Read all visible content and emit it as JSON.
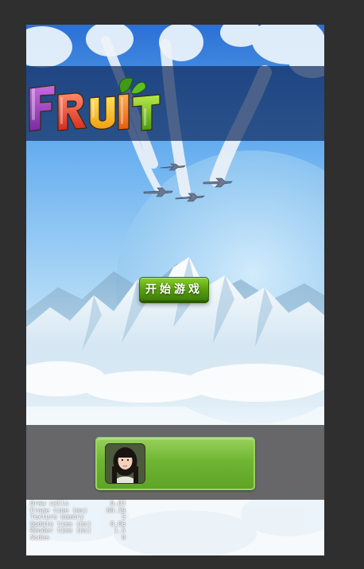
{
  "game": {
    "title_logo_text": "FRUIT",
    "start_button_label": "开始游戏"
  },
  "player": {
    "avatar": "player-portrait",
    "name": ""
  },
  "debug_stats": [
    {
      "label": "Draw calls",
      "value": "0.03"
    },
    {
      "label": "Frame time (ms)",
      "value": "60.19"
    },
    {
      "label": "Texture memory",
      "value": "5"
    },
    {
      "label": "Update time (ms)",
      "value": "0.06"
    },
    {
      "label": "Render time (ms)",
      "value": "1.5"
    },
    {
      "label": "Nodes",
      "value": "0"
    }
  ],
  "colors": {
    "outer_background": "#2f2f2f",
    "sky_top": "#2b6fd4",
    "title_band": "#142d5f",
    "button_green": "#5aa10f",
    "bottom_band": "#5a5a5c",
    "card_green": "#6fb532"
  },
  "icons": {
    "logo": "fruit-logo",
    "planes": "plane-icon"
  }
}
